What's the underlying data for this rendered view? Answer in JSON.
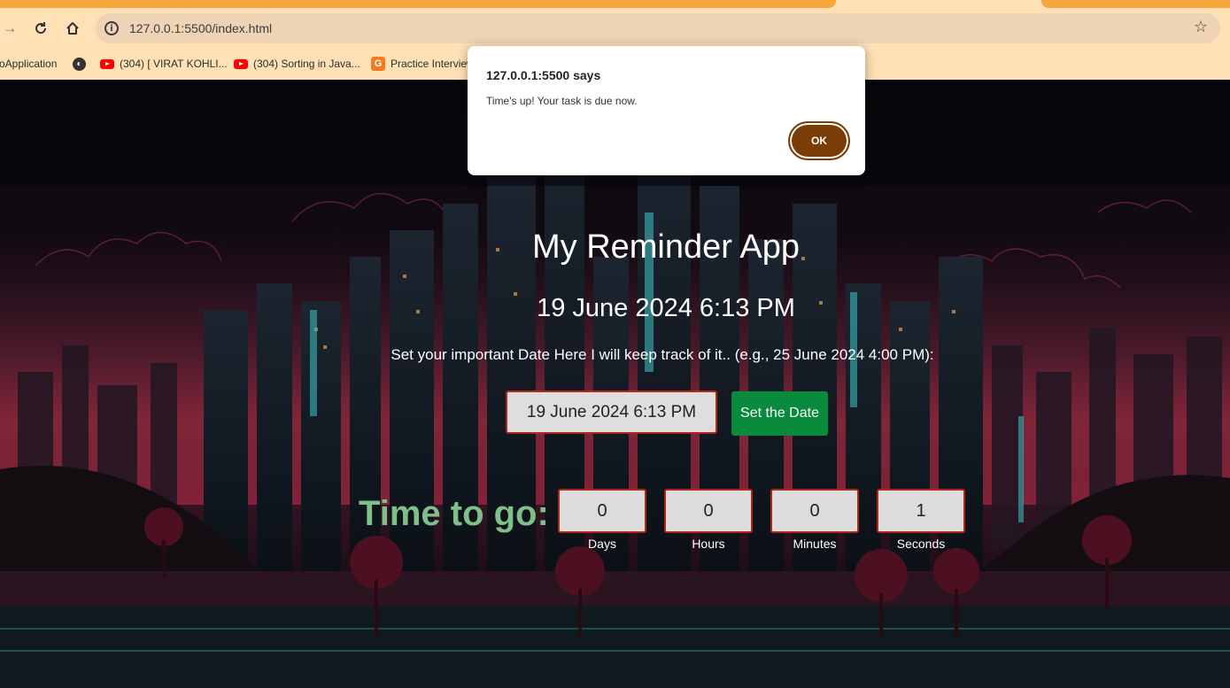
{
  "browser": {
    "url": "127.0.0.1:5500/index.html",
    "bookmarks": [
      {
        "label": "oApplication",
        "icon": "none"
      },
      {
        "label": "",
        "icon": "globe-icon"
      },
      {
        "label": "(304) [ VIRAT KOHLI...",
        "icon": "youtube-icon"
      },
      {
        "label": "(304) Sorting in Java...",
        "icon": "youtube-icon"
      },
      {
        "label": "Practice Interview",
        "icon": "gfg-icon"
      }
    ]
  },
  "dialog": {
    "title": "127.0.0.1:5500 says",
    "message": "Time's up! Your task is due now.",
    "ok_label": "OK"
  },
  "app": {
    "title": "My Reminder App",
    "current_date": "19 June 2024 6:13 PM",
    "instructions": "Set your important Date Here I will keep track of it.. (e.g., 25 June 2024 4:00 PM):",
    "input_value": "19 June 2024 6:13 PM",
    "set_button_label": "Set the Date",
    "time_to_go_label": "Time to go:",
    "countdown": {
      "days": {
        "value": "0",
        "label": "Days"
      },
      "hours": {
        "value": "0",
        "label": "Hours"
      },
      "minutes": {
        "value": "0",
        "label": "Minutes"
      },
      "seconds": {
        "value": "1",
        "label": "Seconds"
      }
    }
  },
  "colors": {
    "browser_frame": "#ffe1b5",
    "tab_accent": "#f6a53c",
    "ok_button": "#7a3d06",
    "set_button": "#0a8a3d",
    "input_border": "#b3261e",
    "time_to_go_text": "#7fbf8a"
  }
}
